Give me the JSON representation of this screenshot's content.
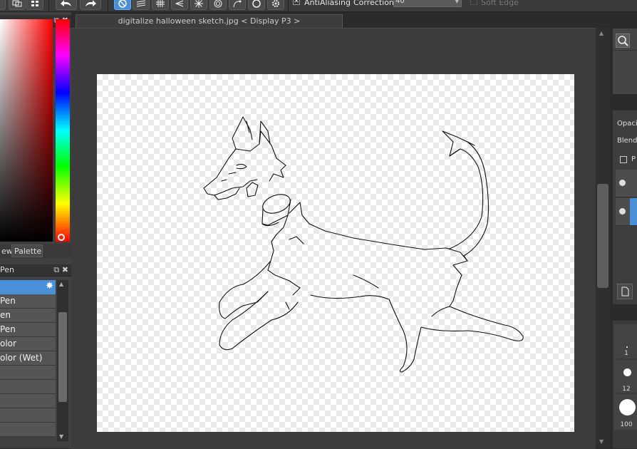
{
  "toolbar": {
    "antialiasing_label": "AntiAliasing",
    "antialiasing_checked": true,
    "correction_label": "Correction",
    "correction_value": "40",
    "soft_edge_label": "Soft Edge",
    "soft_edge_checked": false
  },
  "document": {
    "tab_title": "digitalize halloween sketch.jpg < Display P3 >"
  },
  "color_panel": {
    "tabs": [
      "ew",
      "Palette"
    ]
  },
  "brush_panel": {
    "title": "Pen",
    "items": [
      "",
      "Pen",
      "en",
      "Pen",
      "olor",
      "olor (Wet)",
      "",
      "",
      "",
      "",
      ""
    ]
  },
  "right_panel": {
    "opacity_label": "Opaci",
    "blending_label": "Blendi",
    "protect_label": "P",
    "brush_sizes": [
      "1",
      "12",
      "100"
    ]
  },
  "colors": {
    "accent": "#4a90d9",
    "panel": "#404040",
    "canvas_bg": "#3c3c3c"
  }
}
